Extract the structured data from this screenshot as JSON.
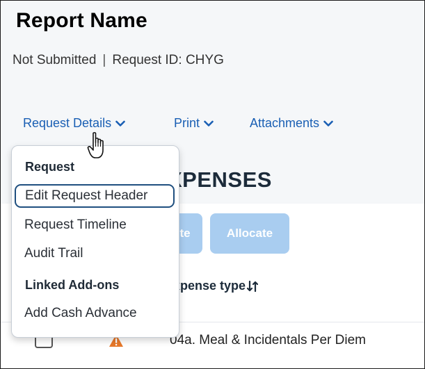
{
  "report": {
    "title": "Report Name",
    "status": "Not Submitted",
    "separator": "|",
    "request_id": "Request ID: CHYG"
  },
  "actions": {
    "request_details": "Request Details",
    "print": "Print",
    "attachments": "Attachments"
  },
  "section": {
    "title": "XPENSES"
  },
  "buttons": {
    "partial_label": "te",
    "allocate_label": "Allocate"
  },
  "table": {
    "column_expense_type": "xpense type",
    "rows": [
      {
        "expense_type": "04a. Meal & Incidentals Per Diem",
        "warning": true
      }
    ]
  },
  "dropdown": {
    "group_request": "Request",
    "items_request": [
      "Edit Request Header",
      "Request Timeline",
      "Audit Trail"
    ],
    "group_addons": "Linked Add-ons",
    "items_addons": [
      "Add Cash Advance"
    ],
    "focused_item": "Edit Request Header"
  },
  "colors": {
    "link": "#1a5fb4",
    "button_disabled": "#a9cdf0",
    "warning": "#e8792b",
    "focus_ring": "#1f4f7f"
  },
  "icons": {
    "chevron": "chevron-down-icon",
    "sort": "sort-icon",
    "warning": "warning-icon",
    "cursor": "hand-cursor-icon"
  }
}
